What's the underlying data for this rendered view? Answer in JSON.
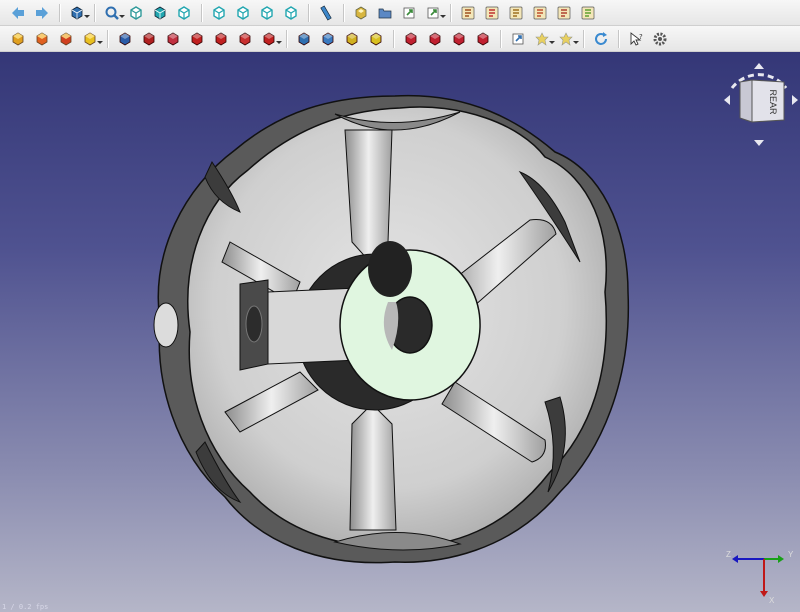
{
  "toolbar_top": {
    "items": [
      {
        "name": "back-arrow-icon",
        "kind": "arrow-left",
        "color": "#5aa0d8"
      },
      {
        "name": "forward-arrow-icon",
        "kind": "arrow-right",
        "color": "#5aa0d8"
      },
      {
        "name": "std-views-icon",
        "kind": "cube-drop",
        "color": "#2f6fb0"
      },
      {
        "name": "zoom-fit-icon",
        "kind": "mag-drop",
        "color": "#2f6fb0"
      },
      {
        "name": "view-isometric-icon",
        "kind": "cube-outline",
        "color": "#2f9a9a"
      },
      {
        "name": "view-front-icon",
        "kind": "cube-solid",
        "color": "#22a6b0"
      },
      {
        "name": "view-top-icon",
        "kind": "cube-outline",
        "color": "#22a6b0"
      },
      {
        "name": "view-right-icon",
        "kind": "cube-outline",
        "color": "#22a6b0"
      },
      {
        "name": "view-rear-icon",
        "kind": "cube-outline",
        "color": "#22a6b0"
      },
      {
        "name": "view-bottom-icon",
        "kind": "cube-outline",
        "color": "#22a6b0"
      },
      {
        "name": "view-left-icon",
        "kind": "cube-outline",
        "color": "#22a6b0"
      },
      {
        "name": "measure-icon",
        "kind": "ruler",
        "color": "#3d86c8"
      },
      {
        "name": "part-icon",
        "kind": "part",
        "color": "#d8b640"
      },
      {
        "name": "group-icon",
        "kind": "folder",
        "color": "#5b88c4"
      },
      {
        "name": "link-icon",
        "kind": "link",
        "color": "#3a8a3a"
      },
      {
        "name": "link-actions-icon",
        "kind": "link-drop",
        "color": "#3a8a3a"
      },
      {
        "name": "macro-record-icon",
        "kind": "macro",
        "color": "#a05020"
      },
      {
        "name": "macro-stop-icon",
        "kind": "macro",
        "color": "#c03030"
      },
      {
        "name": "macro-edit-icon",
        "kind": "macro",
        "color": "#a07020"
      },
      {
        "name": "macro-run-icon",
        "kind": "macro",
        "color": "#c05030"
      },
      {
        "name": "macro-debug-icon",
        "kind": "macro",
        "color": "#b04030"
      },
      {
        "name": "macro-step-icon",
        "kind": "macro",
        "color": "#60a030"
      }
    ]
  },
  "toolbar_bottom": {
    "items": [
      {
        "name": "box-icon",
        "kind": "box",
        "color": "#e0a020"
      },
      {
        "name": "cylinder-icon",
        "kind": "box",
        "color": "#e06020"
      },
      {
        "name": "sphere-icon",
        "kind": "box",
        "color": "#d04020"
      },
      {
        "name": "primitives-icon",
        "kind": "box-drop",
        "color": "#e8c020"
      },
      {
        "name": "extrude-icon",
        "kind": "solid",
        "color": "#2a5ca8"
      },
      {
        "name": "revolve-icon",
        "kind": "solid",
        "color": "#b02020"
      },
      {
        "name": "mirror-icon",
        "kind": "solid",
        "color": "#c03040"
      },
      {
        "name": "fillet-icon",
        "kind": "solid",
        "color": "#c02020"
      },
      {
        "name": "chamfer-icon",
        "kind": "solid",
        "color": "#c02020"
      },
      {
        "name": "face-icon",
        "kind": "solid",
        "color": "#c83030"
      },
      {
        "name": "offset-icon",
        "kind": "solid-drop",
        "color": "#c02020"
      },
      {
        "name": "boolean-icon",
        "kind": "solid",
        "color": "#2f6fb0"
      },
      {
        "name": "cut-icon",
        "kind": "solid",
        "color": "#3a7ac0"
      },
      {
        "name": "fuse-icon",
        "kind": "solid",
        "color": "#d0b020"
      },
      {
        "name": "common-icon",
        "kind": "solid",
        "color": "#d8c020"
      },
      {
        "name": "section-icon",
        "kind": "solid",
        "color": "#c02030"
      },
      {
        "name": "cross-section-icon",
        "kind": "solid",
        "color": "#c02030"
      },
      {
        "name": "thickness-icon",
        "kind": "solid",
        "color": "#c02030"
      },
      {
        "name": "projection-icon",
        "kind": "solid",
        "color": "#c02030"
      },
      {
        "name": "attachment-icon",
        "kind": "link",
        "color": "#2f6fb0"
      },
      {
        "name": "compound-tools-icon",
        "kind": "star-drop",
        "color": "#e8d060"
      },
      {
        "name": "join-features-icon",
        "kind": "star-drop",
        "color": "#e8d060"
      },
      {
        "name": "refresh-icon",
        "kind": "refresh",
        "color": "#3a8ad0"
      },
      {
        "name": "whats-this-icon",
        "kind": "help",
        "color": "#333333"
      },
      {
        "name": "settings-gear-icon",
        "kind": "gear",
        "color": "#555555"
      }
    ]
  },
  "navcube": {
    "face_label": "REAR",
    "face_color": "#e2e2ea"
  },
  "axis": {
    "x_label": "X",
    "y_label": "Y",
    "z_label": "Z",
    "x_color": "#c01818",
    "y_color": "#18a018",
    "z_color": "#1818c0"
  },
  "status": {
    "text": "1 / 0.2 fps"
  },
  "model": {
    "body_color": "#bdbdbd",
    "highlight_color": "#e0f6e0",
    "edge_color": "#111111"
  }
}
